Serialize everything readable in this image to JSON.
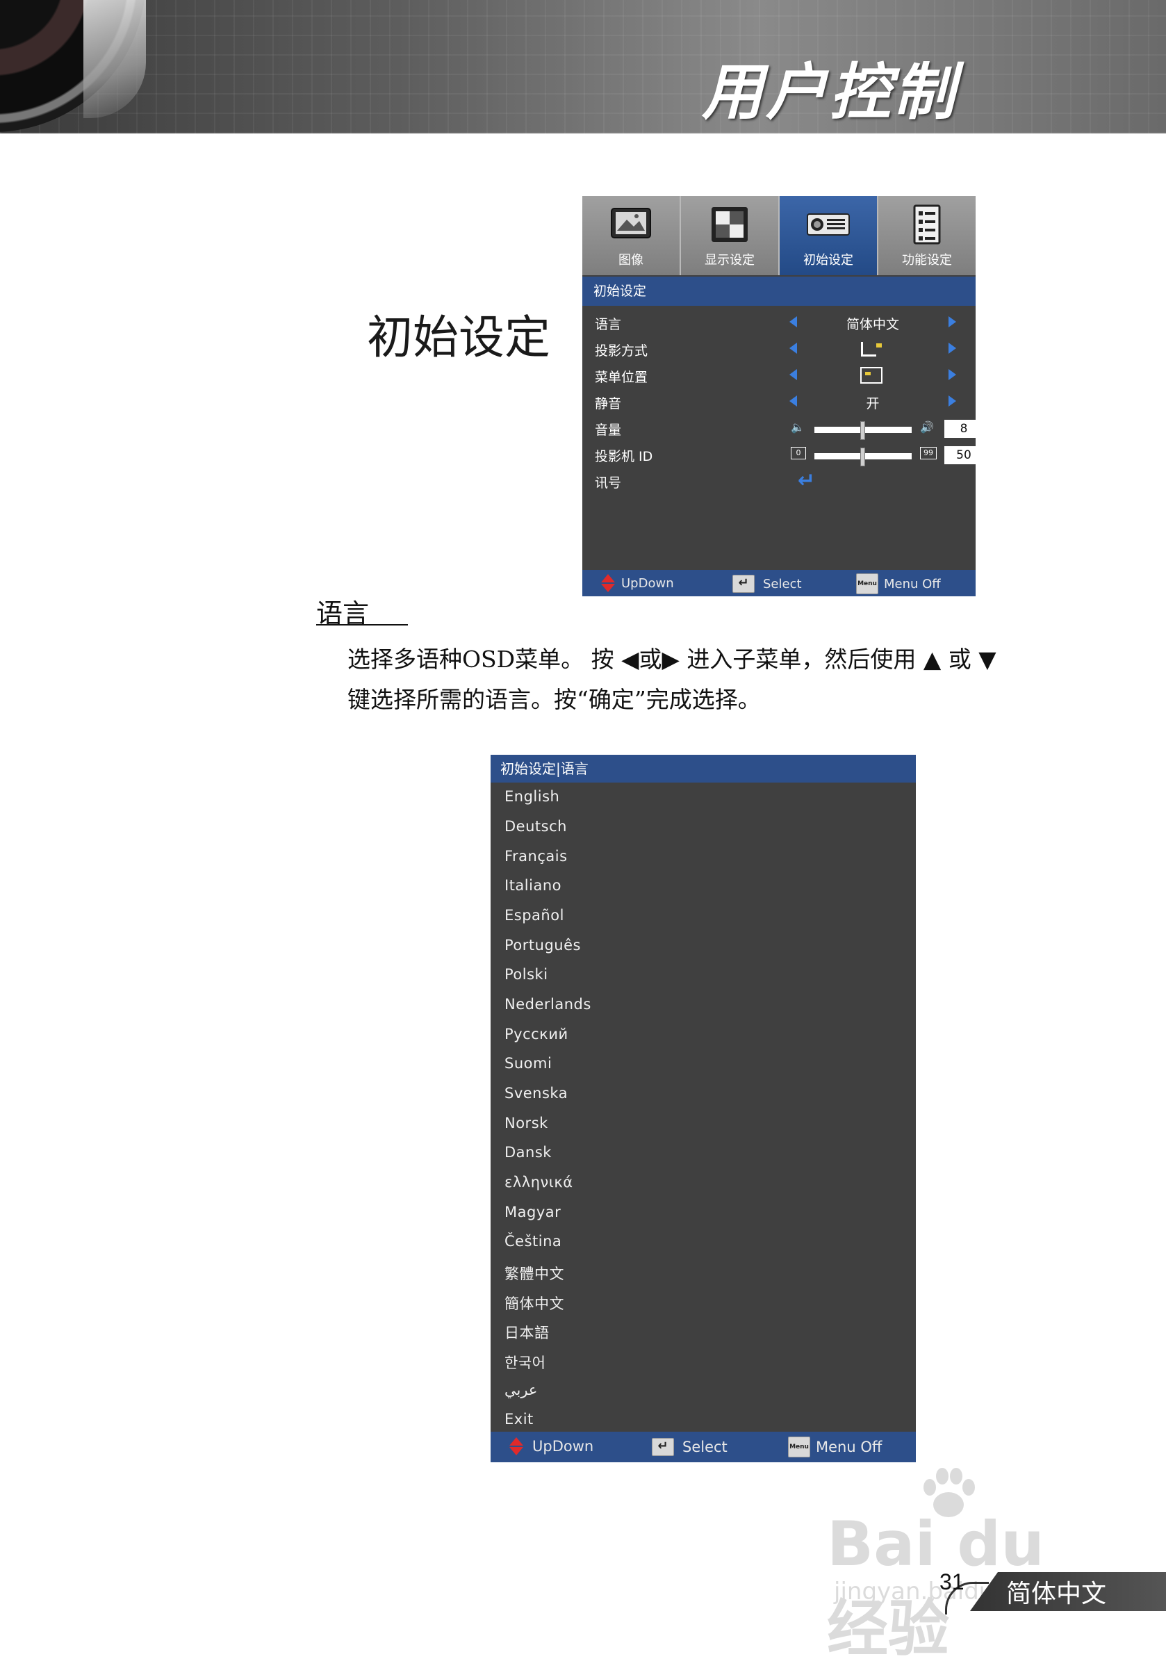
{
  "header": {
    "title": "用户控制"
  },
  "section": {
    "title": "初始设定"
  },
  "osd_setup": {
    "tabs": [
      {
        "label": "图像",
        "icon": "image-icon"
      },
      {
        "label": "显示设定",
        "icon": "display-icon"
      },
      {
        "label": "初始设定",
        "icon": "projector-icon",
        "active": true
      },
      {
        "label": "功能设定",
        "icon": "options-icon"
      }
    ],
    "header": "初始设定",
    "rows": {
      "language": {
        "label": "语言",
        "value": "简体中文"
      },
      "projection": {
        "label": "投影方式"
      },
      "menu_location": {
        "label": "菜单位置"
      },
      "mute": {
        "label": "静音",
        "value": "开"
      },
      "volume": {
        "label": "音量",
        "value": "8",
        "min_label": "",
        "max_label": ""
      },
      "projector_id": {
        "label": "投影机 ID",
        "value": "50",
        "min_label": "0",
        "max_label": "99"
      },
      "signal": {
        "label": "讯号"
      }
    },
    "footer": {
      "updown": "UpDown",
      "select": "Select",
      "menu_key": "Menu",
      "menu_off": "Menu Off"
    }
  },
  "subsection": {
    "title": "语言",
    "line1_part1": "选择多语种OSD菜单。 按",
    "line1_or1": "或",
    "line1_part2": "进入子菜单，然后使用",
    "line1_or2": "或",
    "line2": "键选择所需的语言。按“确定”完成选择。"
  },
  "osd_language": {
    "header": "初始设定|语言",
    "items": [
      "English",
      "Deutsch",
      "Français",
      "Italiano",
      "Español",
      "Português",
      "Polski",
      "Nederlands",
      "Русский",
      "Suomi",
      "Svenska",
      "Norsk",
      "Dansk",
      "ελληνικά",
      "Magyar",
      "Čeština",
      "繁體中文",
      "簡体中文",
      "日本語",
      "한국어",
      "عربي",
      "Exit"
    ],
    "footer": {
      "updown": "UpDown",
      "select": "Select",
      "menu_key": "Menu",
      "menu_off": "Menu Off"
    }
  },
  "footer": {
    "page_number": "31",
    "language_tab": "简体中文"
  },
  "watermark": {
    "brand": "Bai du 经验",
    "url": "jingyan.baidu.com"
  },
  "colors": {
    "osd_bg": "#404040",
    "osd_accent": "#2d4f8a",
    "arrow": "#3b7fe0",
    "updown_icon": "#e02a2a"
  }
}
